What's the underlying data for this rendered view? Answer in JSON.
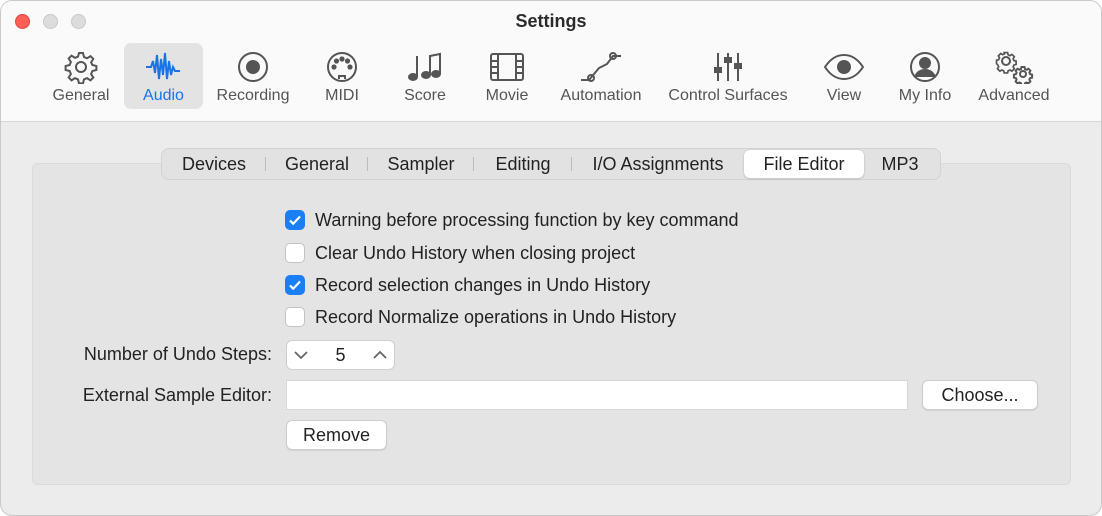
{
  "window": {
    "title": "Settings"
  },
  "toolbar": {
    "items": [
      {
        "label": "General",
        "icon": "gear-icon"
      },
      {
        "label": "Audio",
        "icon": "waveform-icon"
      },
      {
        "label": "Recording",
        "icon": "record-icon"
      },
      {
        "label": "MIDI",
        "icon": "midi-connector-icon"
      },
      {
        "label": "Score",
        "icon": "music-notes-icon"
      },
      {
        "label": "Movie",
        "icon": "film-icon"
      },
      {
        "label": "Automation",
        "icon": "automation-curve-icon"
      },
      {
        "label": "Control Surfaces",
        "icon": "faders-icon"
      },
      {
        "label": "View",
        "icon": "eye-icon"
      },
      {
        "label": "My Info",
        "icon": "person-icon"
      },
      {
        "label": "Advanced",
        "icon": "gears-icon"
      }
    ],
    "selected": "Audio"
  },
  "tabs": {
    "items": [
      "Devices",
      "General",
      "Sampler",
      "Editing",
      "I/O Assignments",
      "File Editor",
      "MP3"
    ],
    "selected": "File Editor"
  },
  "options": [
    {
      "label": "Warning before processing function by key command",
      "checked": true
    },
    {
      "label": "Clear Undo History when closing project",
      "checked": false
    },
    {
      "label": "Record selection changes in Undo History",
      "checked": true
    },
    {
      "label": "Record Normalize operations in Undo History",
      "checked": false
    }
  ],
  "undo_steps": {
    "label": "Number of Undo Steps:",
    "value": "5"
  },
  "sample_editor": {
    "label": "External Sample Editor:",
    "value": "",
    "choose_label": "Choose...",
    "remove_label": "Remove"
  },
  "colors": {
    "accent": "#1a7ff5",
    "close": "#fe5f57"
  }
}
